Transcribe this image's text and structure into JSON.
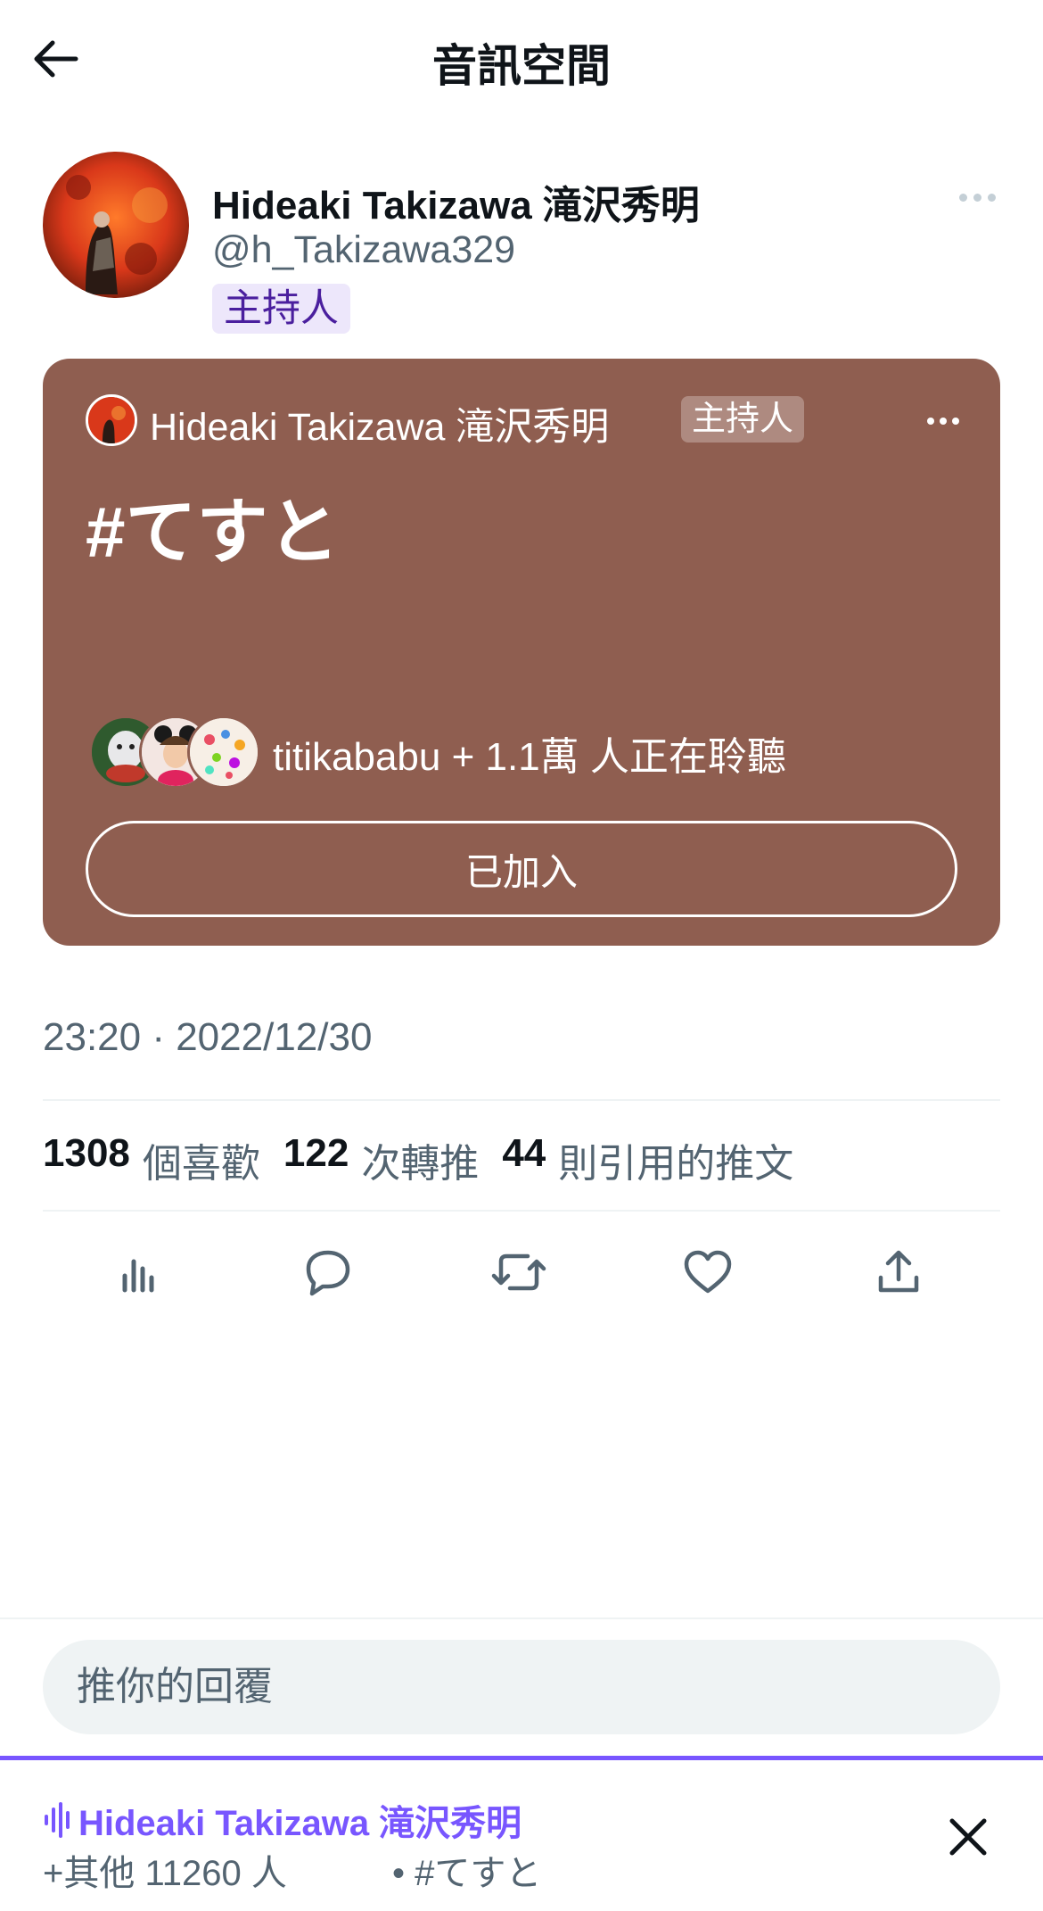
{
  "header": {
    "title": "音訊空間"
  },
  "author": {
    "name": "Hideaki Takizawa 滝沢秀明",
    "handle": "@h_Takizawa329",
    "badge": "主持人"
  },
  "space_card": {
    "host_name": "Hideaki Takizawa 滝沢秀明",
    "host_badge": "主持人",
    "title": "#てすと",
    "listeners_text": "titikababu + 1.1萬 人正在聆聽",
    "join_button": "已加入",
    "background_color": "#8f5e50"
  },
  "timestamp": "23:20 · 2022/12/30",
  "stats": [
    {
      "count": "1308",
      "label": "個喜歡"
    },
    {
      "count": "122",
      "label": "次轉推"
    },
    {
      "count": "44",
      "label": "則引用的推文"
    }
  ],
  "actions": [
    "analytics-icon",
    "reply-icon",
    "retweet-icon",
    "like-icon",
    "share-icon"
  ],
  "reply": {
    "placeholder": "推你的回覆"
  },
  "dock": {
    "host_name": "Hideaki Takizawa 滝沢秀明",
    "listeners": "+其他 11260 人",
    "space_title": "• #てすと",
    "accent_color": "#7856ff"
  }
}
